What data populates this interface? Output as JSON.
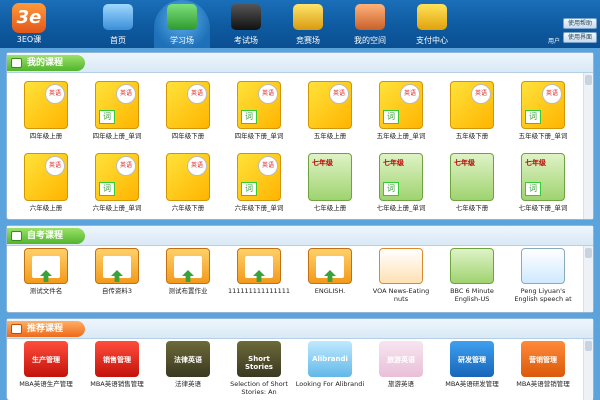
{
  "app": {
    "logo_text": "3EO课",
    "user_label": "用户",
    "side_buttons": [
      "使用帮助",
      "使用界面"
    ]
  },
  "nav": [
    {
      "label": "首页",
      "icon": "home-screen-icon"
    },
    {
      "label": "学习场",
      "icon": "books-icon"
    },
    {
      "label": "考试场",
      "icon": "graduation-cap-icon"
    },
    {
      "label": "竞赛场",
      "icon": "trophy-icon"
    },
    {
      "label": "我的空间",
      "icon": "house-icon"
    },
    {
      "label": "支付中心",
      "icon": "dollar-icon"
    }
  ],
  "my_courses": {
    "title": "我的课程",
    "items": [
      {
        "label": "四年级上册"
      },
      {
        "label": "四年级上册_单词"
      },
      {
        "label": "四年级下册"
      },
      {
        "label": "四年级下册_单词"
      },
      {
        "label": "五年级上册"
      },
      {
        "label": "五年级上册_单词"
      },
      {
        "label": "五年级下册"
      },
      {
        "label": "五年级下册_单词"
      },
      {
        "label": "六年级上册"
      },
      {
        "label": "六年级上册_单词"
      },
      {
        "label": "六年级下册"
      },
      {
        "label": "六年级下册_单词"
      },
      {
        "label": "七年级上册"
      },
      {
        "label": "七年级上册_单词"
      },
      {
        "label": "七年级下册"
      },
      {
        "label": "七年级下册_单词"
      }
    ]
  },
  "self_courses": {
    "title": "自考课程",
    "items": [
      {
        "label": "测试文件名"
      },
      {
        "label": "自传资料3"
      },
      {
        "label": "测试布置作业"
      },
      {
        "label": "111111111111111"
      },
      {
        "label": "ENGLISH."
      },
      {
        "label": "VOA News-Eating nuts"
      },
      {
        "label": "BBC 6 Minute English-US"
      },
      {
        "label": "Peng Liyuan's English speech at"
      }
    ]
  },
  "recommended": {
    "title": "推荐课程",
    "items": [
      {
        "label": "MBA英语生产管理",
        "sub": "生产管理"
      },
      {
        "label": "MBA英语销售管理",
        "sub": "销售管理"
      },
      {
        "label": "法律英语",
        "sub": "法律英语"
      },
      {
        "label": "Selection of Short Stories: An",
        "sub": "Short Stories"
      },
      {
        "label": "Looking For Alibrandi",
        "sub": "Alibrandi"
      },
      {
        "label": "旅游英语",
        "sub": "旅游英语"
      },
      {
        "label": "MBA英语研发管理",
        "sub": "研发管理"
      },
      {
        "label": "MBA英语营销管理",
        "sub": "营销管理"
      }
    ]
  }
}
